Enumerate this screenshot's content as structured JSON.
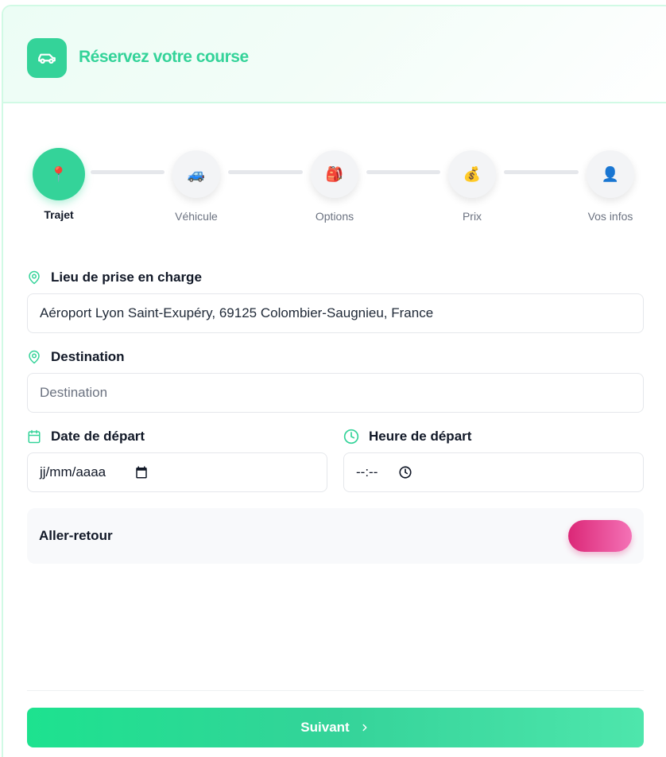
{
  "header": {
    "title": "Réservez votre course",
    "logo_icon": "car-icon"
  },
  "stepper": {
    "steps": [
      {
        "label": "Trajet",
        "icon": "📍",
        "active": true
      },
      {
        "label": "Véhicule",
        "icon": "🚙",
        "active": false
      },
      {
        "label": "Options",
        "icon": "🎒",
        "active": false
      },
      {
        "label": "Prix",
        "icon": "💰",
        "active": false
      },
      {
        "label": "Vos infos",
        "icon": "👤",
        "active": false
      }
    ]
  },
  "form": {
    "pickup": {
      "label": "Lieu de prise en charge",
      "value": "Aéroport Lyon Saint-Exupéry, 69125 Colombier-Saugnieu, France"
    },
    "destination": {
      "label": "Destination",
      "placeholder": "Destination"
    },
    "date": {
      "label": "Date de départ",
      "value": "jj/mm/aaaa"
    },
    "time": {
      "label": "Heure de départ",
      "value": "--:--"
    },
    "round_trip": {
      "label": "Aller-retour"
    }
  },
  "actions": {
    "next_label": "Suivant"
  },
  "colors": {
    "accent": "#34d399",
    "toggle": "#db2777"
  }
}
